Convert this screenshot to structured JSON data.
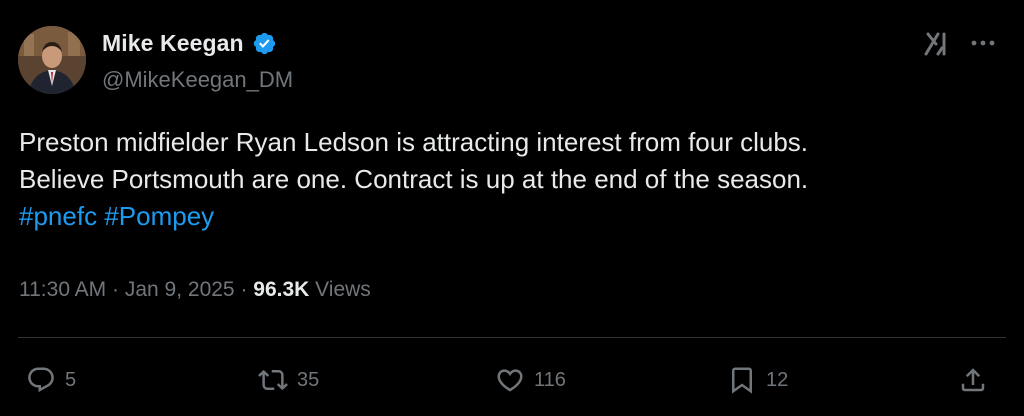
{
  "author": {
    "display_name": "Mike Keegan",
    "handle": "@MikeKeegan_DM",
    "verified": true,
    "avatar_icon": "profile-photo"
  },
  "header_icons": {
    "grok": "grok-icon",
    "more": "more-icon"
  },
  "tweet": {
    "line1": "Preston midfielder Ryan Ledson is attracting interest from four clubs.",
    "line2": "Believe Portsmouth are one. Contract is up at the end of the season.",
    "hashtags": [
      "#pnefc",
      "#Pompey"
    ]
  },
  "meta": {
    "time": "11:30 AM",
    "separator": " · ",
    "date": "Jan 9, 2025",
    "views_count": "96.3K",
    "views_label": "Views"
  },
  "actions": {
    "reply_count": "5",
    "retweet_count": "35",
    "like_count": "116",
    "bookmark_count": "12"
  },
  "colors": {
    "background": "#000000",
    "text": "#e7e9ea",
    "secondary": "#71767b",
    "accent": "#1d9bf0",
    "divider": "#2f3336"
  }
}
